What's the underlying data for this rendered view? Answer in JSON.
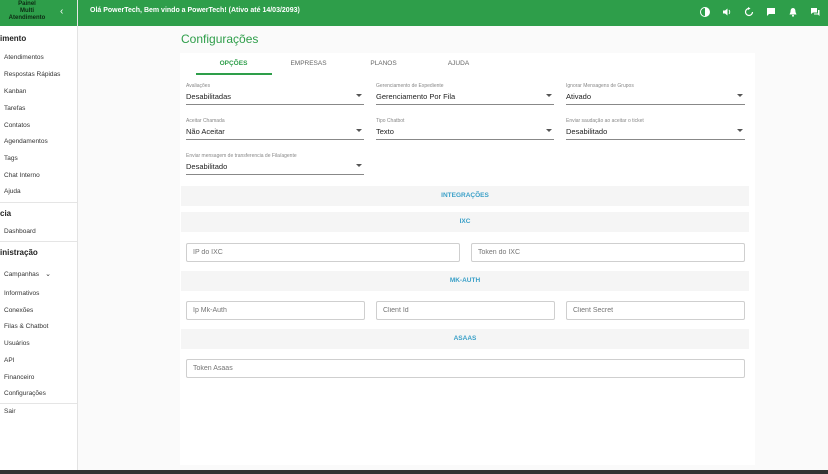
{
  "topbar": {
    "logo_lines": [
      "Painel",
      "Multi",
      "Atendimento"
    ],
    "collapse_glyph": "‹",
    "welcome": "Olá PowerTech, Bem vindo a PowerTech! (Ativo até 14/03/2093)",
    "icons": [
      "contrast-icon",
      "volume-icon",
      "refresh-icon",
      "chat-icon",
      "bell-icon",
      "forum-icon"
    ]
  },
  "sidebar": {
    "sections": [
      {
        "label": "imento",
        "items": [
          "Atendimentos",
          "Respostas Rápidas",
          "Kanban",
          "Tarefas",
          "Contatos",
          "Agendamentos",
          "Tags",
          "Chat Interno",
          "Ajuda"
        ]
      },
      {
        "label": "cia",
        "items": [
          "Dashboard"
        ]
      },
      {
        "label": "inistração",
        "items": [
          "Campanhas",
          "Informativos",
          "Conexões",
          "Filas & Chatbot",
          "Usuários",
          "API",
          "Financeiro",
          "Configurações"
        ]
      }
    ],
    "campanhas_chevron": "⌄",
    "logout": "Sair"
  },
  "page": {
    "title": "Configurações",
    "tabs": [
      "OPÇÕES",
      "EMPRESAS",
      "PLANOS",
      "AJUDA"
    ],
    "active_tab": "OPÇÕES"
  },
  "options": [
    {
      "label": "Avaliações",
      "value": "Desabilitadas"
    },
    {
      "label": "Gerenciamento de Expediente",
      "value": "Gerenciamento Por Fila"
    },
    {
      "label": "Ignorar Mensagens de Grupos",
      "value": "Ativado"
    },
    {
      "label": "Aceitar Chamada",
      "value": "Não Aceitar"
    },
    {
      "label": "Tipo Chatbot",
      "value": "Texto"
    },
    {
      "label": "Enviar saudação ao aceitar o ticket",
      "value": "Desabilitado"
    },
    {
      "label": "Enviar mensagem de transferencia de Fila/agente",
      "value": "Desabilitado"
    }
  ],
  "integrations": {
    "header": "INTEGRAÇÕES",
    "ixc": {
      "header": "IXC",
      "ip_placeholder": "IP do IXC",
      "token_placeholder": "Token do IXC"
    },
    "mkauth": {
      "header": "MK-AUTH",
      "ip_placeholder": "Ip Mk-Auth",
      "client_id_placeholder": "Client Id",
      "client_secret_placeholder": "Client Secret"
    },
    "asaas": {
      "header": "ASAAS",
      "token_placeholder": "Token Asaas"
    }
  },
  "colors": {
    "brand": "#2e9e4a",
    "section_text": "#3aa0c8"
  }
}
